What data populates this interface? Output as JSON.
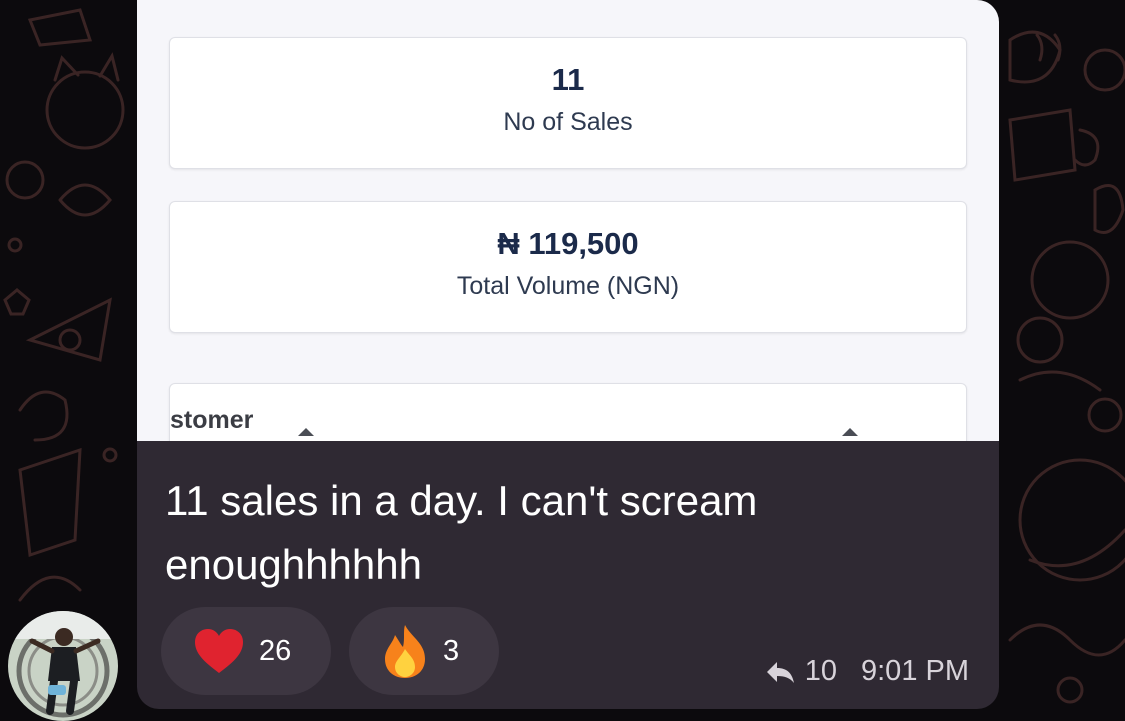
{
  "stats": [
    {
      "value": "11",
      "label": "No of Sales"
    },
    {
      "value": "₦ 119,500",
      "label": "Total Volume (NGN)"
    }
  ],
  "table": {
    "column_label": "stomer"
  },
  "message": {
    "text": "11 sales in a day. I can't scream enoughhhhhh",
    "reactions": [
      {
        "icon": "heart-icon",
        "count": "26"
      },
      {
        "icon": "fire-icon",
        "count": "3"
      }
    ],
    "forwards": "10",
    "time": "9:01 PM"
  },
  "colors": {
    "caption_bg": "#2f2933",
    "reaction_bg": "#3d3641",
    "heart": "#e0232f",
    "fire": "#f7821b",
    "stat_text": "#1b2a4a"
  }
}
